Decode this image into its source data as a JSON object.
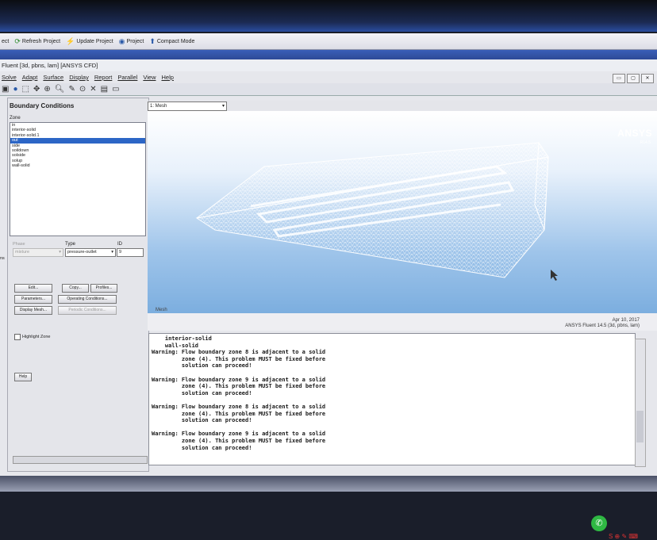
{
  "workbench_toolbar": {
    "items": [
      {
        "icon": "ect",
        "label": "ect"
      },
      {
        "icon": "refresh-icon",
        "label": "Refresh Project"
      },
      {
        "icon": "update-icon",
        "label": "Update Project"
      },
      {
        "icon": "project-icon",
        "label": "Project"
      },
      {
        "icon": "compact-icon",
        "label": "Compact Mode"
      }
    ]
  },
  "window": {
    "title": "Fluent [3d, pbns, lam] [ANSYS CFD]"
  },
  "menu": [
    "Solve",
    "Adapt",
    "Surface",
    "Display",
    "Report",
    "Parallel",
    "View",
    "Help"
  ],
  "boundary_panel": {
    "title": "Boundary Conditions",
    "zone_label": "Zone",
    "zones": [
      "in",
      "interior-solid",
      "interior-solid.1",
      "out",
      "side",
      "soildown",
      "solside",
      "solup",
      "wall-solid"
    ],
    "selected_zone": "out",
    "phase_label": "Phase",
    "phase_value": "mixture",
    "type_label": "Type",
    "type_value": "pressure-outlet",
    "id_label": "ID",
    "id_value": "9",
    "buttons": {
      "edit": "Edit...",
      "copy": "Copy...",
      "profiles": "Profiles...",
      "parameters": "Parameters...",
      "operating": "Operating Conditions...",
      "display_mesh": "Display Mesh...",
      "periodic": "Periodic Conditions...",
      "help": "Help"
    },
    "highlight_zone": "Highlight Zone",
    "side_label": "ns"
  },
  "graphics": {
    "view_select": "1: Mesh",
    "logo": "ANSYS",
    "version": "R14.5",
    "mesh_label": "Mesh",
    "date": "Apr 10, 2017",
    "fluent_info": "ANSYS Fluent 14.5 (3d, pbns, lam)"
  },
  "console": {
    "lines": [
      "    interior-solid",
      "    wall-solid",
      "Warning: Flow boundary zone 8 is adjacent to a solid",
      "         zone (4). This problem MUST be fixed before",
      "         solution can proceed!",
      "",
      "Warning: Flow boundary zone 9 is adjacent to a solid",
      "         zone (4). This problem MUST be fixed before",
      "         solution can proceed!",
      "",
      "Warning: Flow boundary zone 8 is adjacent to a solid",
      "         zone (4). This problem MUST be fixed before",
      "         solution can proceed!",
      "",
      "Warning: Flow boundary zone 9 is adjacent to a solid",
      "         zone (4). This problem MUST be fixed before",
      "         solution can proceed!"
    ]
  },
  "colors": {
    "selection": "#2c66c6",
    "viewport_bottom": "#7caedf",
    "mesh": "#ffffff"
  }
}
